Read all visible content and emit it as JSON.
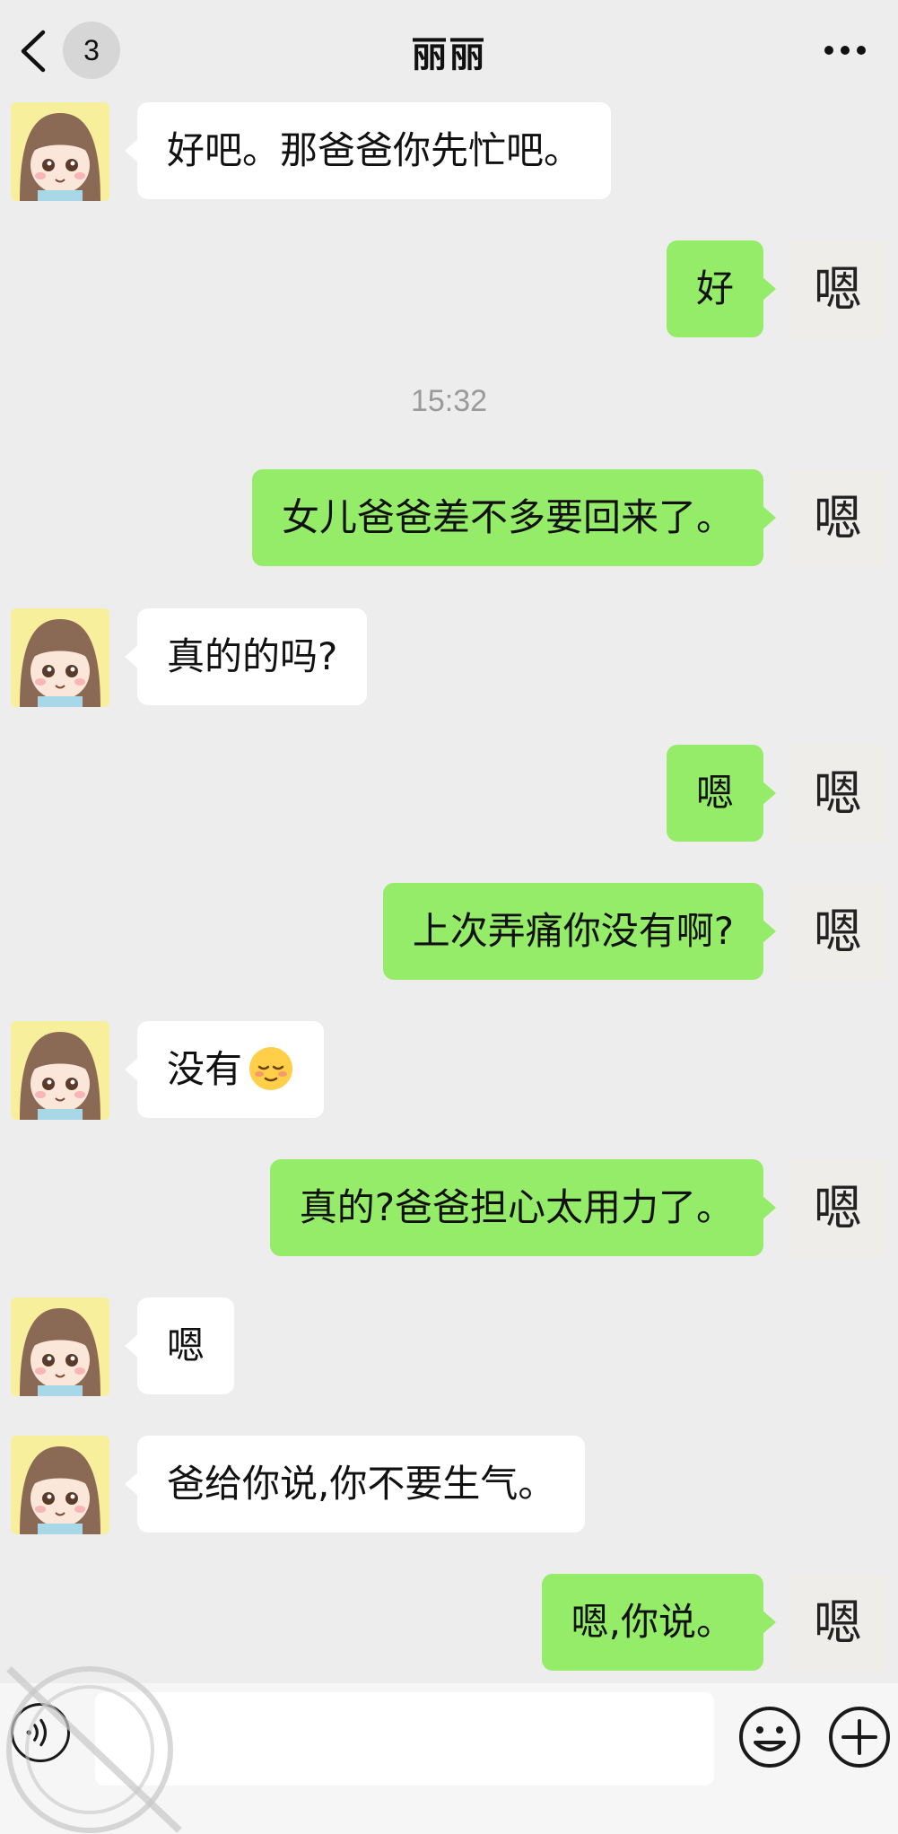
{
  "header": {
    "unread_count": "3",
    "title": "丽丽"
  },
  "messages": [
    {
      "side": "in",
      "text": "好吧。那爸爸你先忙吧。"
    },
    {
      "side": "out",
      "text": "好"
    },
    {
      "timestamp": "15:32"
    },
    {
      "side": "out",
      "text": "女儿爸爸差不多要回来了。"
    },
    {
      "side": "in",
      "text": "真的的吗?"
    },
    {
      "side": "out",
      "text": "嗯"
    },
    {
      "side": "out",
      "text": "上次弄痛你没有啊?"
    },
    {
      "side": "in",
      "text": "没有",
      "emoji": "relieved-face"
    },
    {
      "side": "out",
      "text": "真的?爸爸担心太用力了。"
    },
    {
      "side": "in",
      "text": "嗯"
    },
    {
      "side": "in",
      "text": "爸给你说,你不要生气。"
    },
    {
      "side": "out",
      "text": "嗯,你说。"
    }
  ],
  "self_avatar_text": "嗯",
  "input": {
    "value": "",
    "placeholder": ""
  },
  "icons": [
    "back-icon",
    "more-icon",
    "voice-icon",
    "emoji-icon",
    "plus-icon"
  ],
  "colors": {
    "background": "#ededed",
    "outgoing_bubble": "#95ec69",
    "incoming_bubble": "#ffffff",
    "timestamp": "#9a9a9a"
  }
}
